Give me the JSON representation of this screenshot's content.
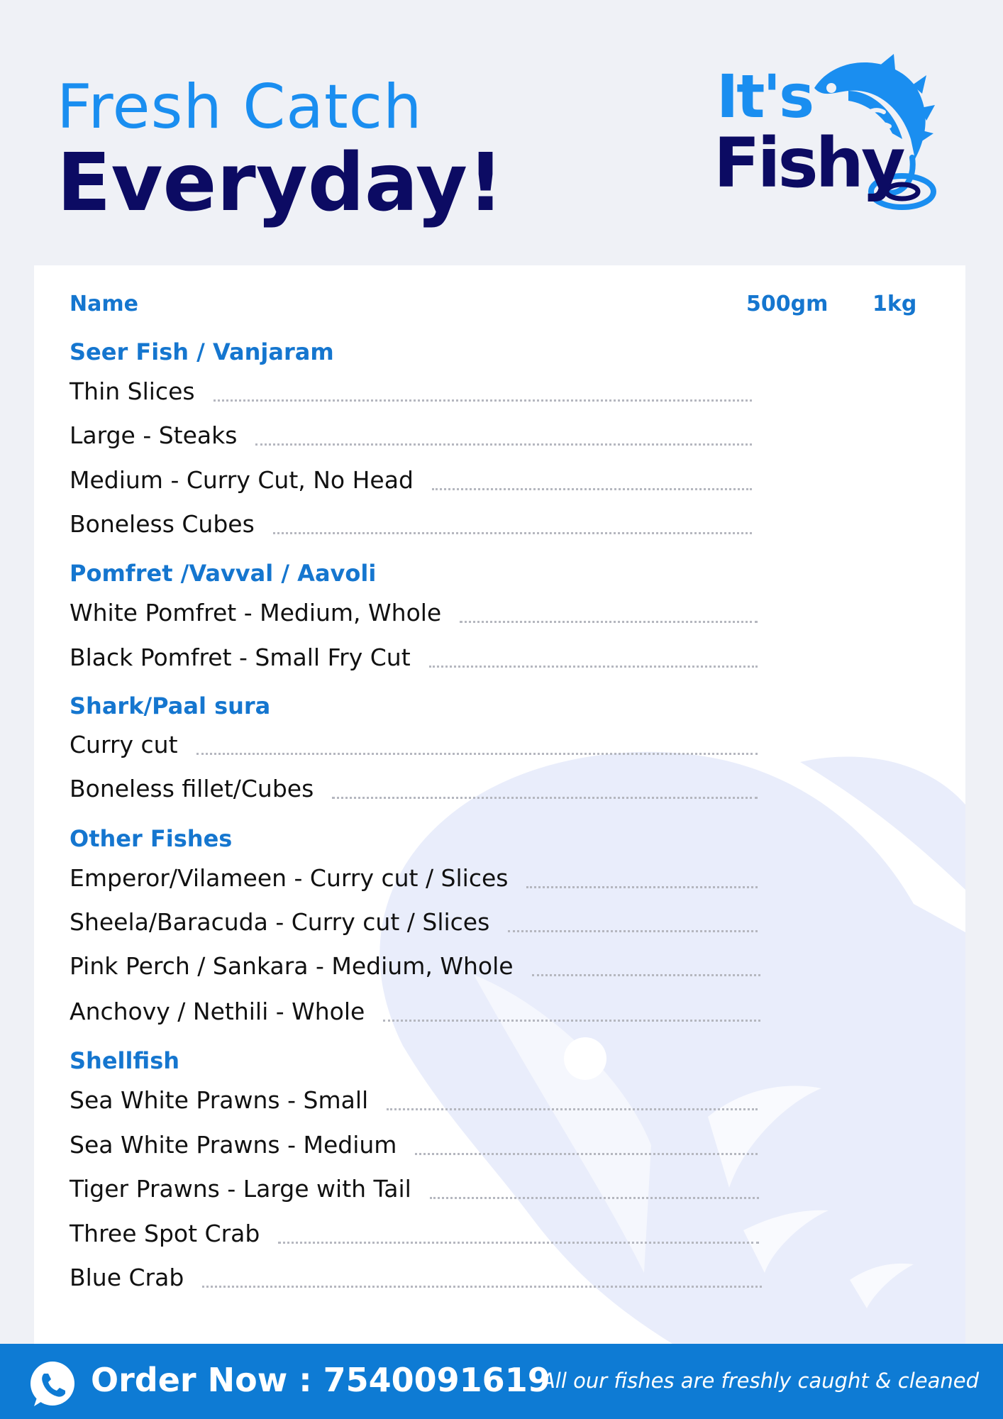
{
  "header": {
    "title_line1": "Fresh Catch",
    "title_line2": "Everyday!",
    "logo_line1": "It's",
    "logo_line2": "Fishy",
    "logo_icon": "fish-hook-icon"
  },
  "table": {
    "col_name": "Name",
    "col_500": "500gm",
    "col_1kg": "1kg"
  },
  "sections": [
    {
      "title": "Seer Fish / Vanjaram",
      "items": [
        "Thin Slices",
        "Large - Steaks",
        "Medium - Curry Cut, No Head",
        "Boneless Cubes"
      ]
    },
    {
      "title": "Pomfret /Vavval / Aavoli",
      "items": [
        "White Pomfret - Medium, Whole",
        "Black Pomfret - Small Fry Cut"
      ]
    },
    {
      "title": "Shark/Paal sura",
      "items": [
        "Curry cut",
        "Boneless fillet/Cubes"
      ]
    },
    {
      "title": "Other Fishes",
      "items": [
        "Emperor/Vilameen - Curry cut / Slices",
        "Sheela/Baracuda - Curry cut / Slices",
        "Pink Perch / Sankara - Medium, Whole",
        "Anchovy / Nethili - Whole"
      ]
    },
    {
      "title": "Shellfish",
      "items": [
        "Sea White Prawns - Small",
        "Sea White Prawns - Medium",
        "Tiger Prawns - Large with Tail",
        "Three Spot Crab",
        "Blue Crab"
      ]
    }
  ],
  "footer": {
    "order_text": "Order Now : 7540091619",
    "tagline": "All our fishes are freshly caught & cleaned",
    "phone_icon": "whatsapp-phone-icon"
  },
  "colors": {
    "brand_blue": "#1a8ef0",
    "navy": "#0c0b63",
    "section_blue": "#1576cf",
    "footer_blue": "#0e7bd4",
    "page_bg": "#eff1f6"
  }
}
